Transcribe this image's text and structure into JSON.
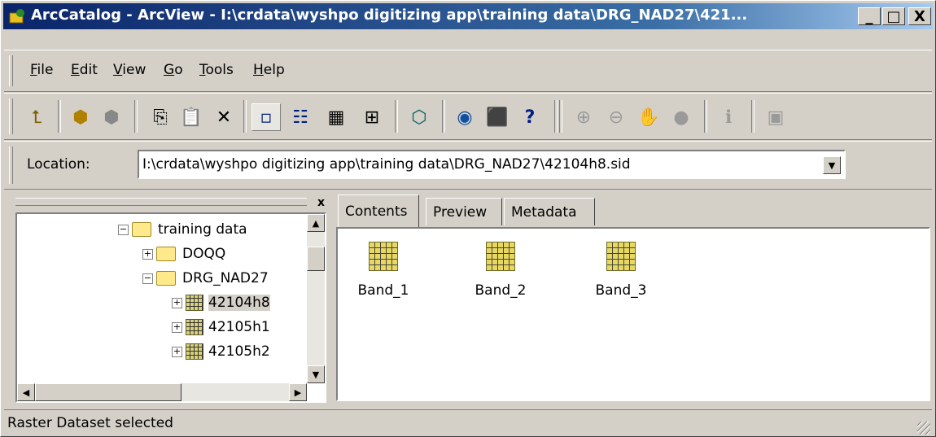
{
  "window": {
    "title": "ArcCatalog - ArcView - I:\\crdata\\wyshpo digitizing app\\training data\\DRG_NAD27\\421...",
    "minimize": "_",
    "maximize": "□",
    "close": "X"
  },
  "menu": [
    {
      "key": "F",
      "rest": "ile"
    },
    {
      "key": "E",
      "rest": "dit"
    },
    {
      "key": "V",
      "rest": "iew"
    },
    {
      "key": "G",
      "rest": "o"
    },
    {
      "key": "T",
      "rest": "ools"
    },
    {
      "key": "H",
      "rest": "elp"
    }
  ],
  "toolbar": {
    "icons": [
      "up-one-level-icon",
      "connect-folder-icon",
      "disconnect-folder-icon",
      "copy-icon",
      "paste-icon",
      "delete-icon",
      "large-icons-icon",
      "list-icon",
      "details-icon",
      "thumbnails-icon",
      "launch-arcmap-icon",
      "search-icon",
      "arctoolbox-icon",
      "whats-this-icon",
      "zoom-in-icon",
      "zoom-out-icon",
      "pan-icon",
      "full-extent-icon",
      "identify-icon",
      "create-thumbnail-icon"
    ],
    "glyphs": [
      "⮤",
      "⬢",
      "⬢",
      "⎘",
      "📋",
      "✕",
      "▫",
      "☷",
      "▦",
      "⊞",
      "⬡",
      "◉",
      "⬛",
      "?",
      "⊕",
      "⊖",
      "✋",
      "●",
      "ℹ",
      "▣"
    ]
  },
  "location": {
    "label": "Location:",
    "value": "I:\\crdata\\wyshpo digitizing app\\training data\\DRG_NAD27\\42104h8.sid"
  },
  "tree": {
    "close": "x",
    "items": [
      {
        "label": "training data",
        "expander": "−",
        "icon": "folder"
      },
      {
        "label": "DOQQ",
        "expander": "+",
        "icon": "folder"
      },
      {
        "label": "DRG_NAD27",
        "expander": "−",
        "icon": "folder"
      },
      {
        "label": "42104h8",
        "expander": "+",
        "icon": "raster"
      },
      {
        "label": "42105h1",
        "expander": "+",
        "icon": "raster"
      },
      {
        "label": "42105h2",
        "expander": "+",
        "icon": "raster"
      }
    ]
  },
  "tabs": [
    {
      "label": "Contents",
      "active": true
    },
    {
      "label": "Preview",
      "active": false
    },
    {
      "label": "Metadata",
      "active": false
    }
  ],
  "contents": [
    "Band_1",
    "Band_2",
    "Band_3"
  ],
  "status": "Raster Dataset selected"
}
